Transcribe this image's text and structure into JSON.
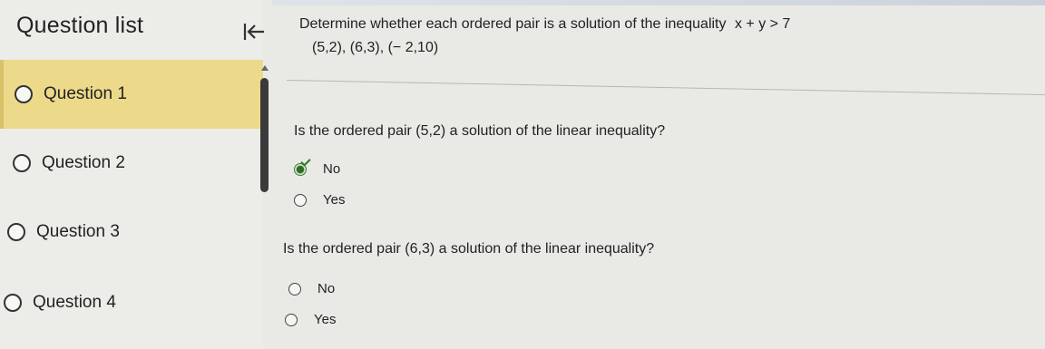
{
  "sidebar": {
    "title": "Question list",
    "questions": [
      {
        "label": "Question 1"
      },
      {
        "label": "Question 2"
      },
      {
        "label": "Question 3"
      },
      {
        "label": "Question 4"
      }
    ]
  },
  "problem": {
    "instruction_prefix": "Determine whether each ordered pair is a solution of the inequality",
    "inequality": "x + y > 7",
    "pairs": "(5,2), (6,3), (− 2,10)"
  },
  "parts": [
    {
      "question": "Is the ordered pair (5,2) a solution of the linear inequality?",
      "options": [
        {
          "label": "No",
          "selected": true
        },
        {
          "label": "Yes",
          "selected": false
        }
      ]
    },
    {
      "question": "Is the ordered pair (6,3) a solution of the linear inequality?",
      "options": [
        {
          "label": "No",
          "selected": false
        },
        {
          "label": "Yes",
          "selected": false
        }
      ]
    }
  ],
  "colors": {
    "active_item": "#ecd98a",
    "selected_check": "#2a7a22"
  },
  "icons": {
    "collapse": "collapse-left-icon"
  }
}
